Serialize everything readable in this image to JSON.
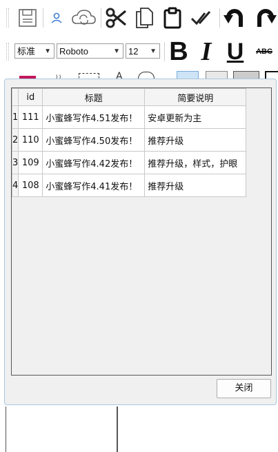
{
  "toolbar": {
    "icons": [
      "save-icon",
      "user-icon",
      "cloud-sync-icon",
      "cut-icon",
      "copy-icon",
      "paste-icon",
      "check-all-icon",
      "undo-icon",
      "redo-icon"
    ],
    "style_combo": "标准",
    "font_combo": "Roboto",
    "size_combo": "12",
    "bold_label": "B",
    "italic_label": "I",
    "underline_label": "U",
    "strike_label": "ABC"
  },
  "dialog": {
    "columns": [
      "id",
      "标题",
      "简要说明"
    ],
    "rows": [
      {
        "num": "1",
        "id": "111",
        "title": "小蜜蜂写作4.51发布！",
        "desc": "安卓更新为主"
      },
      {
        "num": "2",
        "id": "110",
        "title": "小蜜蜂写作4.50发布！",
        "desc": "推荐升级"
      },
      {
        "num": "3",
        "id": "109",
        "title": "小蜜蜂写作4.42发布！",
        "desc": "推荐升级，样式，护眼"
      },
      {
        "num": "4",
        "id": "108",
        "title": "小蜜蜂写作4.41发布！",
        "desc": "推荐升级"
      }
    ],
    "close_label": "关闭"
  },
  "colors": {
    "accent_blue": "#3a7bd5",
    "dialog_border": "#a9c7de",
    "magenta_bar": "#c2185b"
  }
}
